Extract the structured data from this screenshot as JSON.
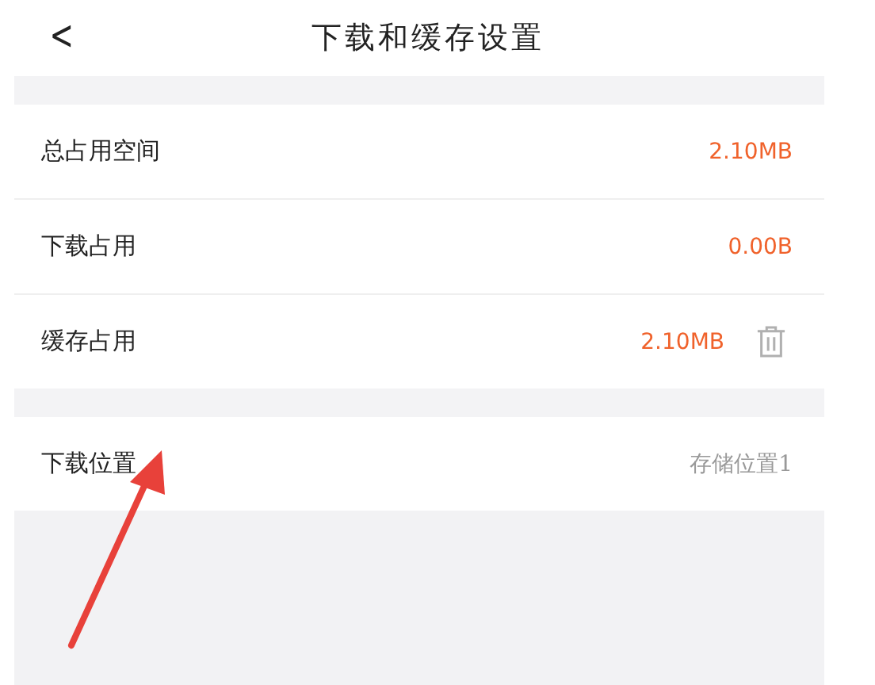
{
  "header": {
    "back": "<",
    "title": "下载和缓存设置"
  },
  "sections": [
    {
      "rows": [
        {
          "label": "总占用空间",
          "value": "2.10MB",
          "kind": "size",
          "clearable": false
        },
        {
          "label": "下载占用",
          "value": "0.00B",
          "kind": "size",
          "clearable": false
        },
        {
          "label": "缓存占用",
          "value": "2.10MB",
          "kind": "size",
          "clearable": true
        }
      ]
    },
    {
      "rows": [
        {
          "label": "下载位置",
          "value": "存储位置1",
          "kind": "location",
          "clearable": false
        }
      ]
    }
  ]
}
